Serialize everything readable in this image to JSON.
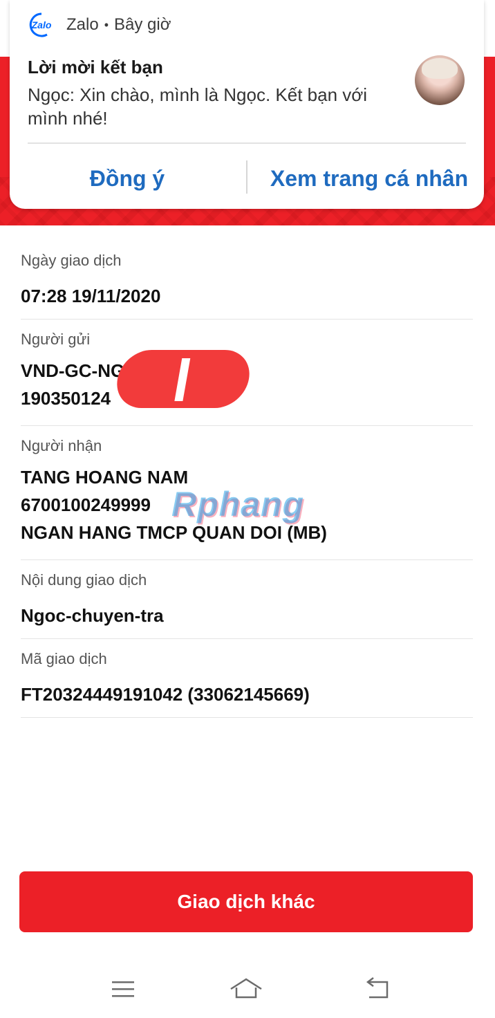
{
  "notification": {
    "app_logo_text": "Zalo",
    "app_name": "Zalo",
    "separator": "•",
    "time": "Bây giờ",
    "title": "Lời mời kết bạn",
    "body": "Ngọc: Xin chào, mình là Ngọc. Kết bạn với mình nhé!",
    "actions": {
      "accept": "Đồng ý",
      "view_profile": "Xem trang cá nhân"
    }
  },
  "transaction": {
    "date": {
      "label": "Ngày giao dịch",
      "value": "07:28 19/11/2020"
    },
    "sender": {
      "label": "Người gửi",
      "lines": [
        "VND-GC-NG",
        "190350124"
      ]
    },
    "receiver": {
      "label": "Người nhận",
      "lines": [
        "TANG HOANG NAM",
        "6700100249999",
        "NGAN HANG TMCP QUAN DOI (MB)"
      ]
    },
    "content": {
      "label": "Nội dung giao dịch",
      "value": "Ngoc-chuyen-tra"
    },
    "code": {
      "label": "Mã giao dịch",
      "value": "FT20324449191042 (33062145669)"
    }
  },
  "watermark": "Rphang",
  "buttons": {
    "other_transaction": "Giao dịch khác"
  },
  "colors": {
    "brand_red": "#ec2027",
    "link_blue": "#1f6bbf",
    "zalo_blue": "#0068ff"
  },
  "navbar": {
    "icons": [
      "menu-icon",
      "home-icon",
      "back-icon"
    ]
  }
}
